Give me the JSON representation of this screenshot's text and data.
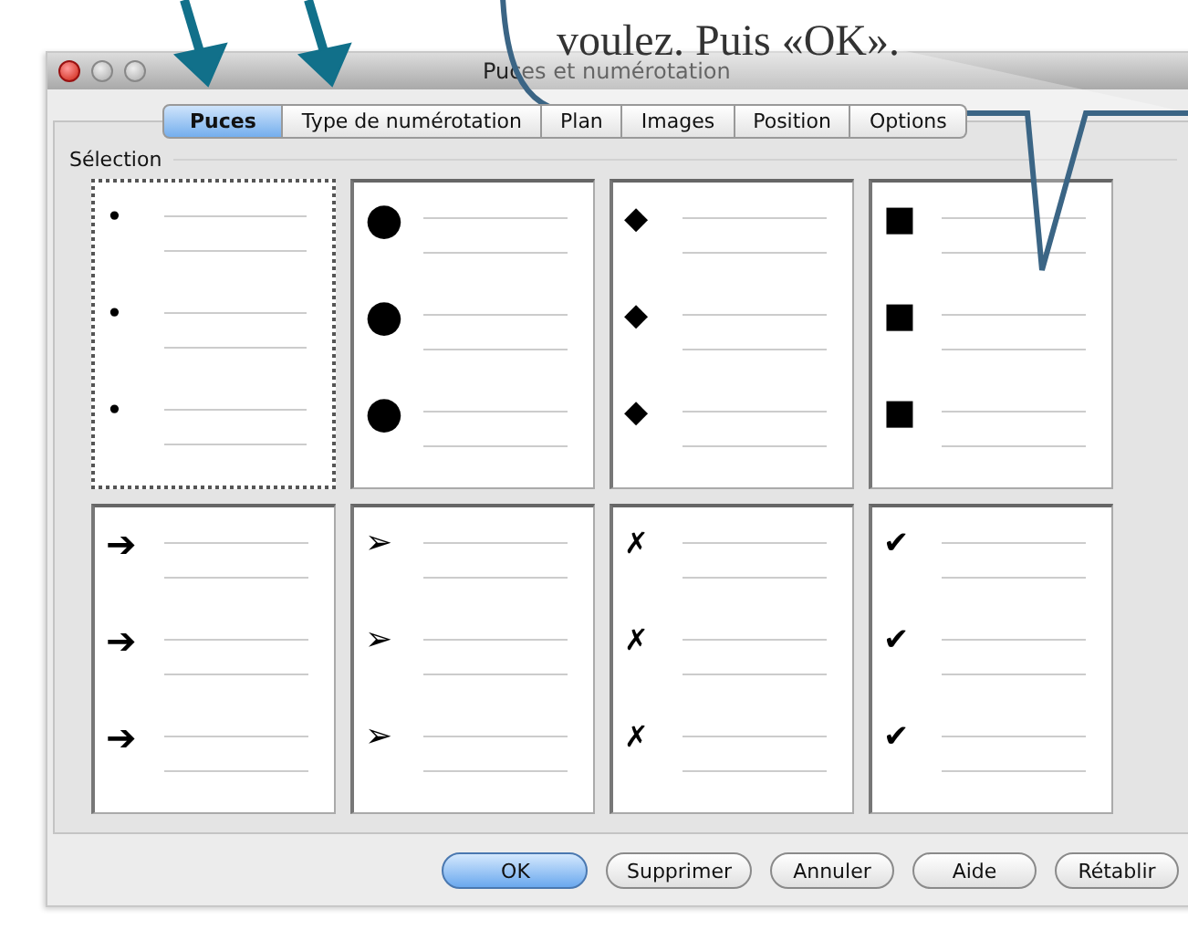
{
  "callout": {
    "text": "voulez. Puis «OK»."
  },
  "window": {
    "title": "Puces et numérotation"
  },
  "tabs": [
    {
      "label": "Puces",
      "selected": true
    },
    {
      "label": "Type de numérotation",
      "selected": false
    },
    {
      "label": "Plan",
      "selected": false
    },
    {
      "label": "Images",
      "selected": false
    },
    {
      "label": "Position",
      "selected": false
    },
    {
      "label": "Options",
      "selected": false
    }
  ],
  "section": {
    "label": "Sélection"
  },
  "styles": [
    {
      "kind": "small-dot",
      "symbols": [
        "•",
        "•",
        "•"
      ],
      "selected": true
    },
    {
      "kind": "dot",
      "symbols": [
        "●",
        "●",
        "●"
      ],
      "selected": false
    },
    {
      "kind": "diamond",
      "symbols": [
        "◆",
        "◆",
        "◆"
      ],
      "selected": false
    },
    {
      "kind": "square",
      "symbols": [
        "■",
        "■",
        "■"
      ],
      "selected": false
    },
    {
      "kind": "arrow",
      "symbols": [
        "➔",
        "➔",
        "➔"
      ],
      "selected": false
    },
    {
      "kind": "arrowhead",
      "symbols": [
        "➢",
        "➢",
        "➢"
      ],
      "selected": false
    },
    {
      "kind": "cross",
      "symbols": [
        "✗",
        "✗",
        "✗"
      ],
      "selected": false
    },
    {
      "kind": "check",
      "symbols": [
        "✔",
        "✔",
        "✔"
      ],
      "selected": false
    }
  ],
  "buttons": [
    {
      "label": "OK",
      "default": true
    },
    {
      "label": "Supprimer",
      "default": false
    },
    {
      "label": "Annuler",
      "default": false
    },
    {
      "label": "Aide",
      "default": false
    },
    {
      "label": "Rétablir",
      "default": false
    }
  ]
}
